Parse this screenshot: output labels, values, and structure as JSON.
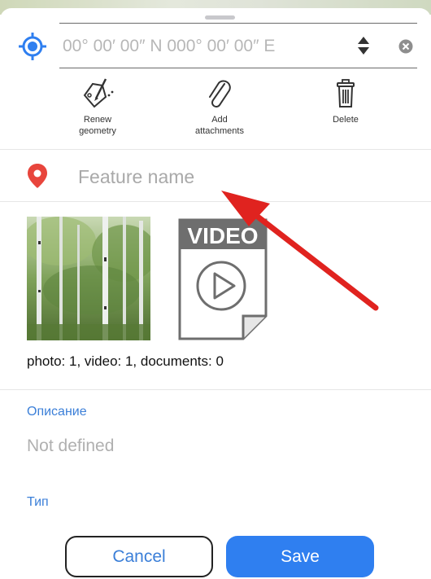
{
  "coordinates": {
    "placeholder": "00° 00′ 00″ N 000° 00′ 00″ E"
  },
  "toolbar": {
    "renew_geometry": {
      "label": "Renew\ngeometry",
      "icon": "polygon-edit-icon"
    },
    "add_attachments": {
      "label": "Add\nattachments",
      "icon": "paperclip-icon"
    },
    "delete": {
      "label": "Delete",
      "icon": "trash-icon"
    }
  },
  "feature": {
    "name_placeholder": "Feature name",
    "pin_color": "#e8453c"
  },
  "attachments": {
    "video_badge": "VIDEO",
    "summary": "photo: 1, video: 1, documents: 0"
  },
  "fields": [
    {
      "label": "Описание",
      "value": "Not defined"
    },
    {
      "label": "Тип"
    }
  ],
  "buttons": {
    "cancel": "Cancel",
    "save": "Save"
  },
  "colors": {
    "accent": "#2f7ff0",
    "label_blue": "#3b7fd8",
    "annotation_arrow": "#e0231f"
  }
}
